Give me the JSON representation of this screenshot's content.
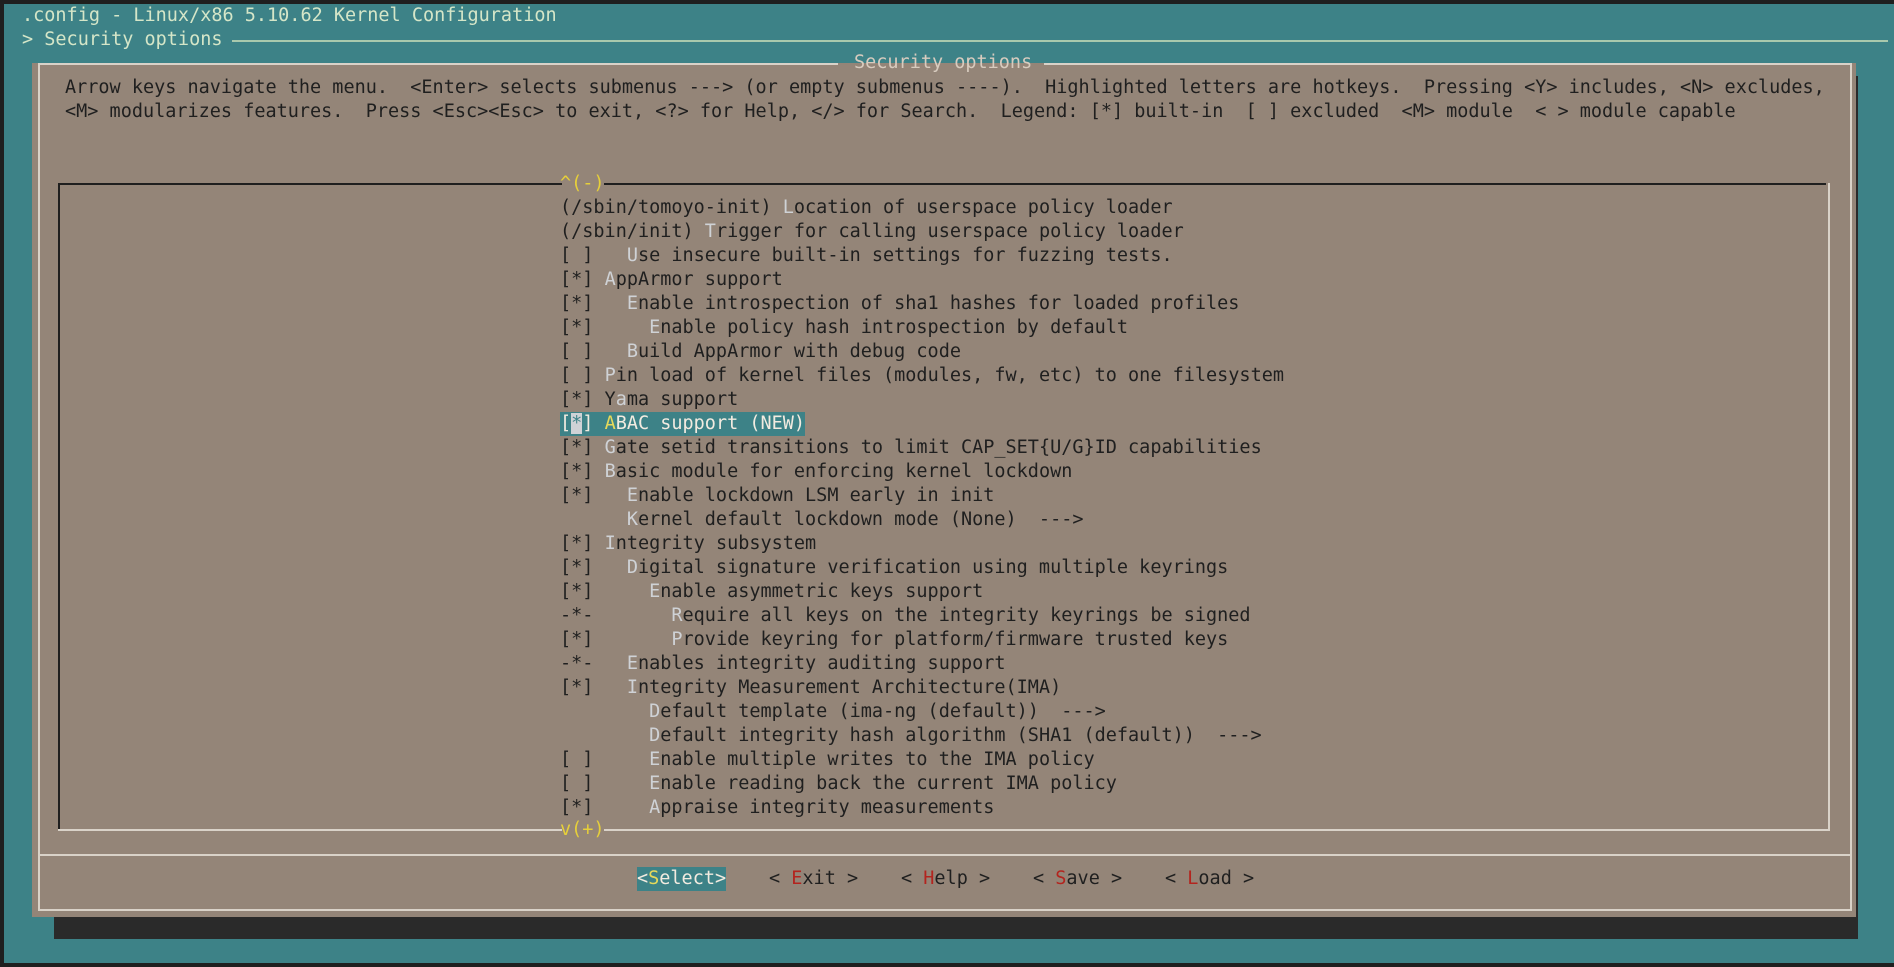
{
  "window": {
    "title": ".config - Linux/x86 5.10.62 Kernel Configuration",
    "breadcrumb": "> Security options"
  },
  "dialog": {
    "title": "Security options",
    "help_lines": [
      "Arrow keys navigate the menu.  <Enter> selects submenus ---> (or empty submenus ----).  Highlighted letters are hotkeys.  Pressing <Y> includes, <N> excludes,",
      "<M> modularizes features.  Press <Esc><Esc> to exit, <?> for Help, </> for Search.  Legend: [*] built-in  [ ] excluded  <M> module  < > module capable"
    ],
    "scroll_up": "^(-)",
    "scroll_down": "v(+)"
  },
  "menu": {
    "selected_index": 9,
    "items": [
      {
        "pre": "(/sbin/tomoyo-init) ",
        "hot": "L",
        "post": "ocation of userspace policy loader"
      },
      {
        "pre": "(/sbin/init) ",
        "hot": "T",
        "post": "rigger for calling userspace policy loader"
      },
      {
        "pre": "[ ]   ",
        "hot": "U",
        "post": "se insecure built-in settings for fuzzing tests."
      },
      {
        "pre": "[*] ",
        "hot": "A",
        "post": "ppArmor support"
      },
      {
        "pre": "[*]   ",
        "hot": "E",
        "post": "nable introspection of sha1 hashes for loaded profiles"
      },
      {
        "pre": "[*]     ",
        "hot": "E",
        "post": "nable policy hash introspection by default"
      },
      {
        "pre": "[ ]   ",
        "hot": "B",
        "post": "uild AppArmor with debug code"
      },
      {
        "pre": "[ ] ",
        "hot": "P",
        "post": "in load of kernel files (modules, fw, etc) to one filesystem"
      },
      {
        "pre": "[*] Y",
        "hot": "a",
        "post": "ma support"
      },
      {
        "pre": "[*] ",
        "hot": "A",
        "post": "BAC support (NEW)"
      },
      {
        "pre": "[*] ",
        "hot": "G",
        "post": "ate setid transitions to limit CAP_SET{U/G}ID capabilities"
      },
      {
        "pre": "[*] ",
        "hot": "B",
        "post": "asic module for enforcing kernel lockdown"
      },
      {
        "pre": "[*]   ",
        "hot": "E",
        "post": "nable lockdown LSM early in init"
      },
      {
        "pre": "      ",
        "hot": "K",
        "post": "ernel default lockdown mode (None)  --->"
      },
      {
        "pre": "[*] ",
        "hot": "I",
        "post": "ntegrity subsystem"
      },
      {
        "pre": "[*]   ",
        "hot": "D",
        "post": "igital signature verification using multiple keyrings"
      },
      {
        "pre": "[*]     ",
        "hot": "E",
        "post": "nable asymmetric keys support"
      },
      {
        "pre": "-*-       ",
        "hot": "R",
        "post": "equire all keys on the integrity keyrings be signed"
      },
      {
        "pre": "[*]       ",
        "hot": "P",
        "post": "rovide keyring for platform/firmware trusted keys"
      },
      {
        "pre": "-*-   ",
        "hot": "E",
        "post": "nables integrity auditing support"
      },
      {
        "pre": "[*]   ",
        "hot": "I",
        "post": "ntegrity Measurement Architecture(IMA)"
      },
      {
        "pre": "        ",
        "hot": "D",
        "post": "efault template (ima-ng (default))  --->"
      },
      {
        "pre": "        ",
        "hot": "D",
        "post": "efault integrity hash algorithm (SHA1 (default))  --->"
      },
      {
        "pre": "[ ]     ",
        "hot": "E",
        "post": "nable multiple writes to the IMA policy"
      },
      {
        "pre": "[ ]     ",
        "hot": "E",
        "post": "nable reading back the current IMA policy"
      },
      {
        "pre": "[*]     ",
        "hot": "A",
        "post": "ppraise integrity measurements"
      }
    ]
  },
  "buttons": {
    "select": {
      "a": "<",
      "k": "S",
      "b": "elect>"
    },
    "exit": {
      "a": "< ",
      "k": "E",
      "b": "xit >"
    },
    "help": {
      "a": "< ",
      "k": "H",
      "b": "elp >"
    },
    "save": {
      "a": "< ",
      "k": "S",
      "b": "ave >"
    },
    "load": {
      "a": "< ",
      "k": "L",
      "b": "oad >"
    }
  },
  "colors": {
    "terminal_bg": "#3d8287",
    "dialog_bg": "#948578",
    "hotkey": "#cfd2d6",
    "scroll_indicator": "#e6cf3a",
    "button_hotkey": "#b3241e"
  }
}
